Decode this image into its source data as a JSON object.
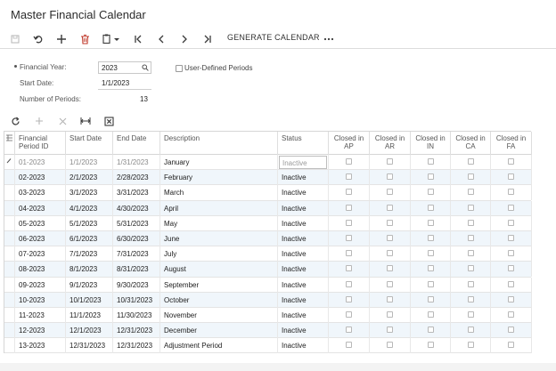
{
  "page": {
    "title": "Master Financial Calendar"
  },
  "toolbar": {
    "generate_label": "GENERATE CALENDAR",
    "icons": [
      "save-icon",
      "undo-icon",
      "add-icon",
      "delete-icon",
      "copy-paste-icon",
      "first-record-icon",
      "previous-record-icon",
      "next-record-icon",
      "last-record-icon",
      "more-icon"
    ]
  },
  "form": {
    "financial_year_label": "Financial Year:",
    "financial_year_value": "2023",
    "user_defined_label": "User-Defined Periods",
    "start_date_label": "Start Date:",
    "start_date_value": "1/1/2023",
    "num_periods_label": "Number of Periods:",
    "num_periods_value": "13"
  },
  "grid": {
    "columns": {
      "period_id": "Financial Period ID",
      "start_date": "Start Date",
      "end_date": "End Date",
      "description": "Description",
      "status": "Status",
      "closed_ap": "Closed in AP",
      "closed_ar": "Closed in AR",
      "closed_in": "Closed in IN",
      "closed_ca": "Closed in CA",
      "closed_fa": "Closed in FA"
    },
    "rows": [
      {
        "id": "01-2023",
        "start": "1/1/2023",
        "end": "1/31/2023",
        "desc": "January",
        "status": "Inactive"
      },
      {
        "id": "02-2023",
        "start": "2/1/2023",
        "end": "2/28/2023",
        "desc": "February",
        "status": "Inactive"
      },
      {
        "id": "03-2023",
        "start": "3/1/2023",
        "end": "3/31/2023",
        "desc": "March",
        "status": "Inactive"
      },
      {
        "id": "04-2023",
        "start": "4/1/2023",
        "end": "4/30/2023",
        "desc": "April",
        "status": "Inactive"
      },
      {
        "id": "05-2023",
        "start": "5/1/2023",
        "end": "5/31/2023",
        "desc": "May",
        "status": "Inactive"
      },
      {
        "id": "06-2023",
        "start": "6/1/2023",
        "end": "6/30/2023",
        "desc": "June",
        "status": "Inactive"
      },
      {
        "id": "07-2023",
        "start": "7/1/2023",
        "end": "7/31/2023",
        "desc": "July",
        "status": "Inactive"
      },
      {
        "id": "08-2023",
        "start": "8/1/2023",
        "end": "8/31/2023",
        "desc": "August",
        "status": "Inactive"
      },
      {
        "id": "09-2023",
        "start": "9/1/2023",
        "end": "9/30/2023",
        "desc": "September",
        "status": "Inactive"
      },
      {
        "id": "10-2023",
        "start": "10/1/2023",
        "end": "10/31/2023",
        "desc": "October",
        "status": "Inactive"
      },
      {
        "id": "11-2023",
        "start": "11/1/2023",
        "end": "11/30/2023",
        "desc": "November",
        "status": "Inactive"
      },
      {
        "id": "12-2023",
        "start": "12/1/2023",
        "end": "12/31/2023",
        "desc": "December",
        "status": "Inactive"
      },
      {
        "id": "13-2023",
        "start": "12/31/2023",
        "end": "12/31/2023",
        "desc": "Adjustment Period",
        "status": "Inactive"
      }
    ]
  }
}
